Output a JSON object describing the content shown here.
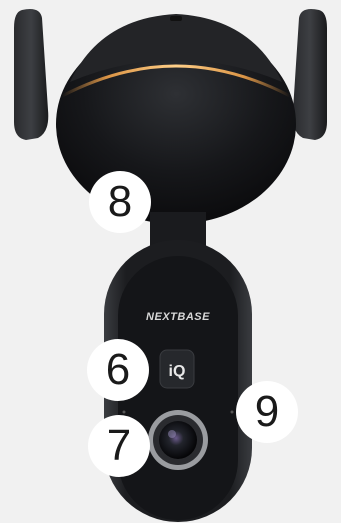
{
  "image": {
    "brand_logo_text": "NEXTBASE",
    "iq_logo_text": "iQ",
    "colors": {
      "background": "#f1f1f1",
      "device_body": "#1c1d20",
      "speaker_dome": "#141517",
      "glow_ring": "#f0a24a",
      "callout_fill": "#ffffff",
      "callout_text": "#1a1a1a"
    },
    "callouts": [
      {
        "label": "8"
      },
      {
        "label": "6"
      },
      {
        "label": "9"
      },
      {
        "label": "7"
      }
    ]
  }
}
